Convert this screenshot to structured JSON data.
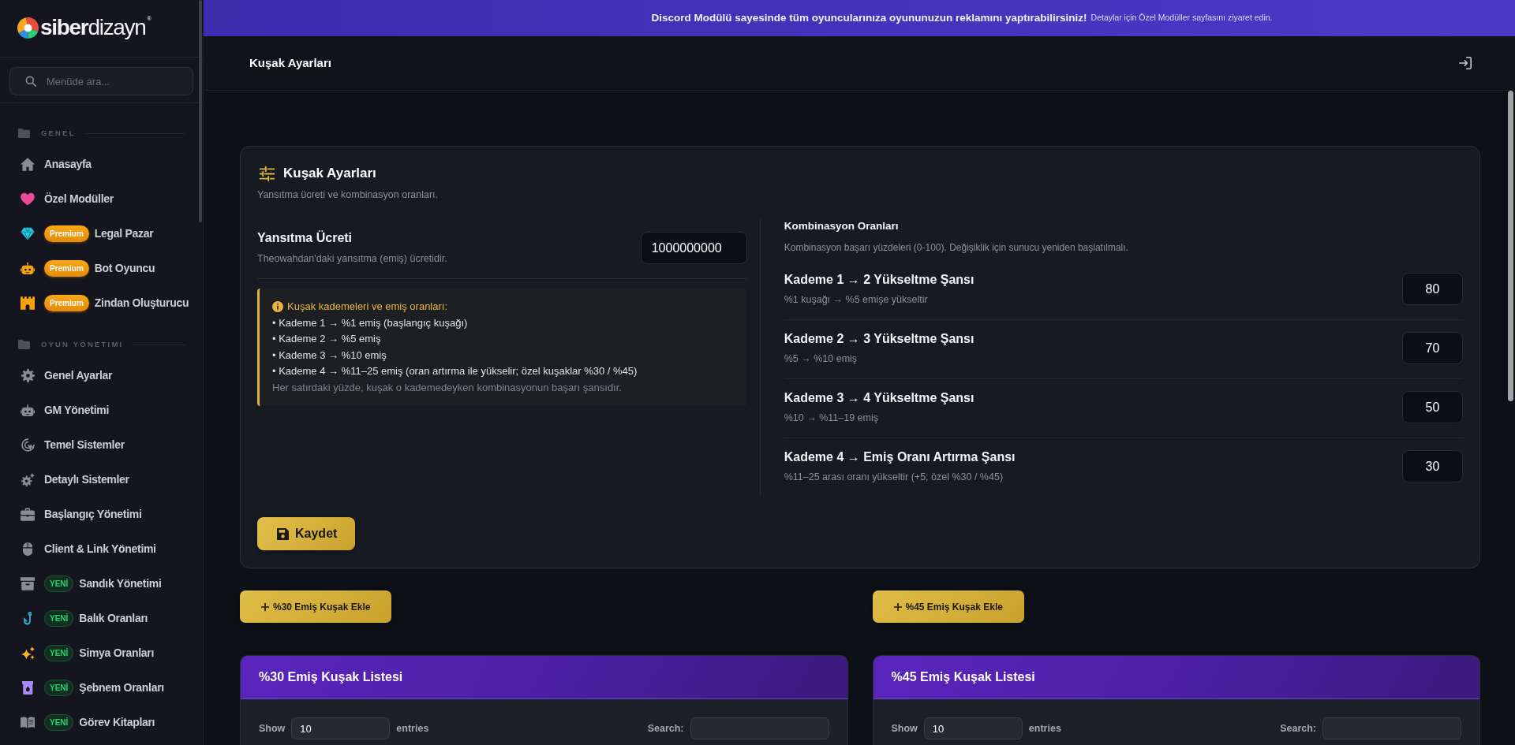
{
  "sidebar": {
    "logo": "**siber**dizayn$^{®}$",
    "search": {
      "placeholder": "Menüde ara..."
    },
    "sections": [
      {
        "title": "GENEL",
        "items": [
          {
            "label": "Anasayfa",
            "selected": false
          },
          {
            "label": "Özel Modüller",
            "selected": false
          },
          {
            "label": "Legal Pazar",
            "selected": false,
            "badge": {
              "kind": "premium",
              "label": "Premium"
            }
          },
          {
            "label": "Bot Oyuncu",
            "selected": false,
            "badge": {
              "kind": "premium",
              "label": "Premium"
            }
          },
          {
            "label": "Zindan Oluşturucu",
            "selected": false,
            "badge": {
              "kind": "premium",
              "label": "Premium"
            }
          }
        ]
      },
      {
        "title": "OYUN YÖNETIMI",
        "items": [
          {
            "label": "Genel Ayarlar",
            "selected": false
          },
          {
            "label": "GM Yönetimi",
            "selected": false
          },
          {
            "label": "Temel Sistemler",
            "selected": false
          },
          {
            "label": "Detaylı Sistemler",
            "selected": false
          },
          {
            "label": "Başlangıç Yönetimi",
            "selected": false
          },
          {
            "label": "Client & Link Yönetimi",
            "selected": false
          },
          {
            "label": "Sandık Yönetimi",
            "selected": false,
            "badge": {
              "kind": "new",
              "label": "YENİ"
            }
          },
          {
            "label": "Balık Oranları",
            "selected": false,
            "badge": {
              "kind": "new",
              "label": "YENİ"
            }
          },
          {
            "label": "Simya Oranları",
            "selected": false,
            "badge": {
              "kind": "new",
              "label": "YENİ"
            }
          },
          {
            "label": "Şebnem Oranları",
            "selected": false,
            "badge": {
              "kind": "new",
              "label": "YENİ"
            }
          },
          {
            "label": "Görev Kitapları",
            "selected": false,
            "badge": {
              "kind": "new",
              "label": "YENİ"
            }
          }
        ]
      }
    ]
  },
  "banner": {
    "headline": "Discord Modülü sayesinde tüm oyuncularınıza oyununuzun reklamını yaptırabilirsiniz!",
    "detail": "Detaylar için Özel Modüller sayfasını ziyaret edin."
  },
  "header": {
    "title": "Kuşak Ayarları"
  },
  "settings_card": {
    "title": "Kuşak Ayarları",
    "subtitle": "Yansıtma ücreti ve kombinasyon oranları.",
    "fee": {
      "label": "Yansıtma Ücreti",
      "description": "Theowahdan'daki yansıtma (emiş) ücretidir.",
      "value": "1000000000"
    },
    "info": {
      "heading": "Kuşak kademeleri ve emiş oranları:",
      "lines": [
        "• Kademe 1 → %1 emiş (başlangıç kuşağı)",
        "• Kademe 2 → %5 emiş",
        "• Kademe 3 → %10 emiş",
        "• Kademe 4 → %11–25 emiş (oran artırma ile yükselir; özel kuşaklar %30 / %45)"
      ],
      "note": "Her satırdaki yüzde, kuşak o kademedeyken kombinasyonun başarı şansıdır."
    },
    "combination": {
      "title": "Kombinasyon Oranları",
      "description": "Kombinasyon başarı yüzdeleri (0-100). Değişiklik için sunucu yeniden başlatılmalı.",
      "rows": [
        {
          "label": "Kademe 1 → 2 Yükseltme Şansı",
          "hint": "%1 kuşağı → %5 emişe yükseltir",
          "value": "80"
        },
        {
          "label": "Kademe 2 → 3 Yükseltme Şansı",
          "hint": "%5 → %10 emiş",
          "value": "70"
        },
        {
          "label": "Kademe 3 → 4 Yükseltme Şansı",
          "hint": "%10 → %11–19 emiş",
          "value": "50"
        },
        {
          "label": "Kademe 4 → Emiş Oranı Artırma Şansı",
          "hint": "%11–25 arası oranı yükseltir (+5; özel %30 / %45)",
          "value": "30"
        }
      ]
    },
    "save_button": "Kaydet"
  },
  "lists": [
    {
      "add_button": "%30 Emiş Kuşak Ekle",
      "title": "%30 Emiş Kuşak Listesi",
      "show_label": "Show",
      "page_size": "10",
      "entries_label": "entries",
      "search_label": "Search:"
    },
    {
      "add_button": "%45 Emiş Kuşak Ekle",
      "title": "%45 Emiş Kuşak Listesi",
      "show_label": "Show",
      "page_size": "10",
      "entries_label": "entries",
      "search_label": "Search:"
    }
  ]
}
